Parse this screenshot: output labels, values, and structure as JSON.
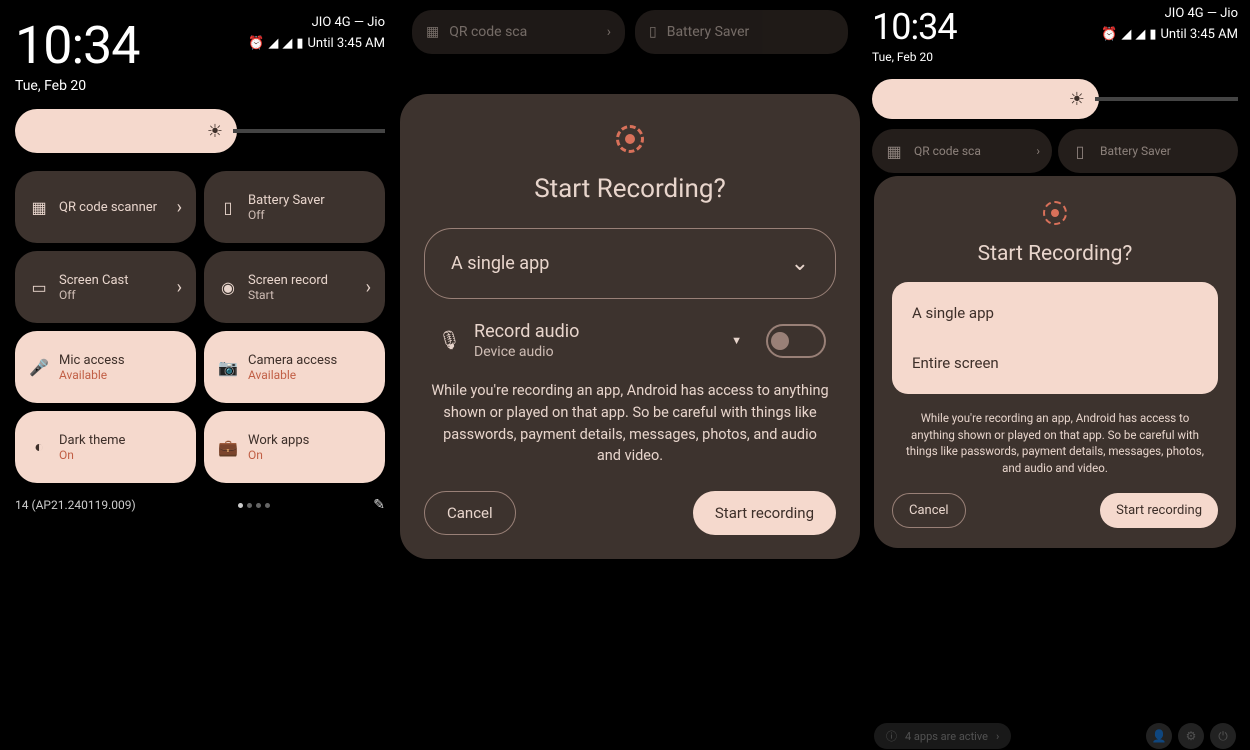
{
  "panel1": {
    "time": "10:34",
    "date": "Tue, Feb 20",
    "carrier": "JIO 4G — Jio",
    "until": "Until 3:45 AM",
    "tiles": [
      {
        "title": "QR code scanner",
        "sub": "",
        "icon": "qr",
        "active": false,
        "chevron": true
      },
      {
        "title": "Battery Saver",
        "sub": "Off",
        "icon": "battery",
        "active": false,
        "chevron": false
      },
      {
        "title": "Screen Cast",
        "sub": "Off",
        "icon": "cast",
        "active": false,
        "chevron": true
      },
      {
        "title": "Screen record",
        "sub": "Start",
        "icon": "record",
        "active": false,
        "chevron": true
      },
      {
        "title": "Mic access",
        "sub": "Available",
        "icon": "mic",
        "active": true,
        "accent": true
      },
      {
        "title": "Camera access",
        "sub": "Available",
        "icon": "camera",
        "active": true,
        "accent": true
      },
      {
        "title": "Dark theme",
        "sub": "On",
        "icon": "dark",
        "active": true,
        "accent": true
      },
      {
        "title": "Work apps",
        "sub": "On",
        "icon": "work",
        "active": true,
        "accent": true
      }
    ],
    "build": "14 (AP21.240119.009)"
  },
  "panel2": {
    "partial": {
      "qr": "QR code sca",
      "battery": "Battery Saver"
    },
    "title": "Start Recording?",
    "select": "A single app",
    "audio_title": "Record audio",
    "audio_sub": "Device audio",
    "warning": "While you're recording an app, Android has access to anything shown or played on that app. So be careful with things like passwords, payment details, messages, photos, and audio and video.",
    "cancel": "Cancel",
    "start": "Start recording"
  },
  "panel3": {
    "time": "10:34",
    "date": "Tue, Feb 20",
    "carrier": "JIO 4G — Jio",
    "until": "Until 3:45 AM",
    "tiles": [
      {
        "title": "QR code sca",
        "icon": "qr"
      },
      {
        "title": "Battery Saver",
        "icon": "battery"
      }
    ],
    "title": "Start Recording?",
    "options": [
      "A single app",
      "Entire screen"
    ],
    "warning": "While you're recording an app, Android has access to anything shown or played on that app. So be careful with things like passwords, payment details, messages, photos, and audio and video.",
    "cancel": "Cancel",
    "start": "Start recording",
    "apps_active": "4 apps are active"
  }
}
